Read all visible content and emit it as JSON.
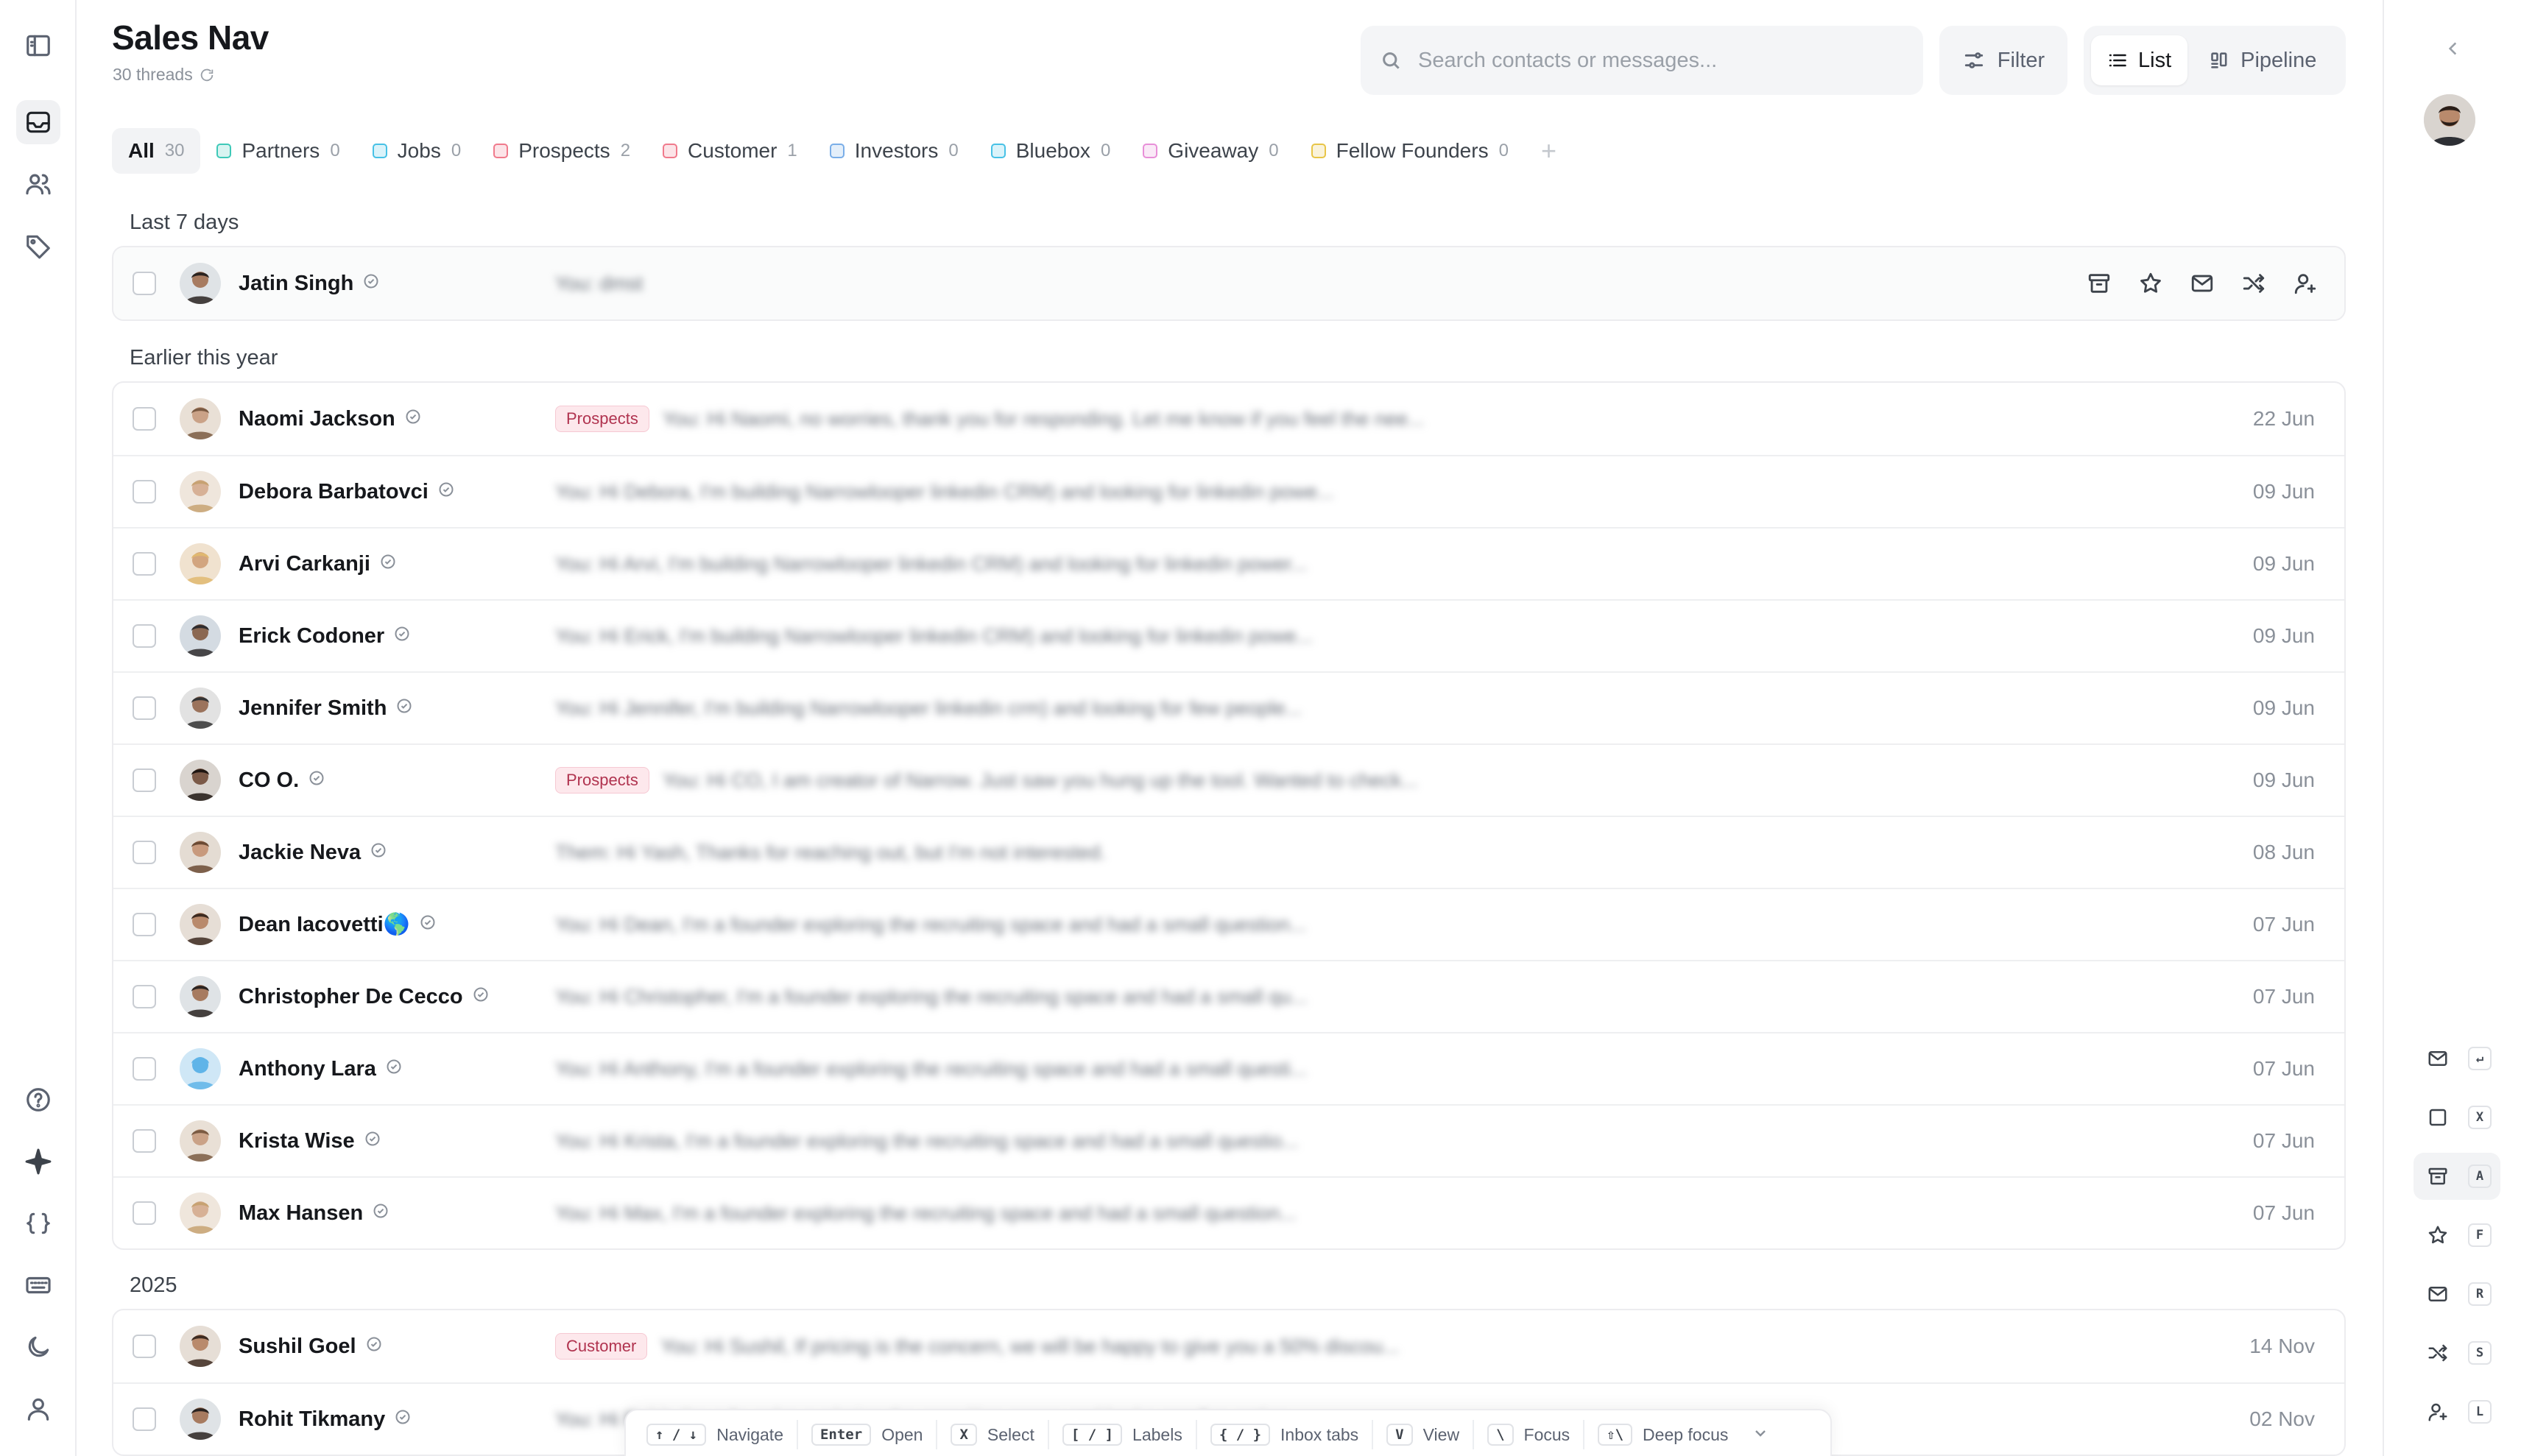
{
  "header": {
    "title": "Sales Nav",
    "subtitle": "30 threads",
    "search_placeholder": "Search contacts or messages...",
    "filter_label": "Filter",
    "view_list": "List",
    "view_pipeline": "Pipeline"
  },
  "tabs": [
    {
      "label": "All",
      "count": "30",
      "color": ""
    },
    {
      "label": "Partners",
      "count": "0",
      "color": "#3ec9b8"
    },
    {
      "label": "Jobs",
      "count": "0",
      "color": "#47c1e6"
    },
    {
      "label": "Prospects",
      "count": "2",
      "color": "#f07a8c"
    },
    {
      "label": "Customer",
      "count": "1",
      "color": "#f07a8c"
    },
    {
      "label": "Investors",
      "count": "0",
      "color": "#7aaee8"
    },
    {
      "label": "Bluebox",
      "count": "0",
      "color": "#47c1e6"
    },
    {
      "label": "Giveaway",
      "count": "0",
      "color": "#e88fd8"
    },
    {
      "label": "Fellow Founders",
      "count": "0",
      "color": "#e8c547"
    }
  ],
  "tab_add": "+",
  "sections": {
    "last7": "Last 7 days",
    "earlier": "Earlier this year",
    "y2025": "2025"
  },
  "threads_last7": [
    {
      "name": "Jatin Singh",
      "label": "",
      "preview": "You: dmst",
      "date": ""
    }
  ],
  "threads_earlier": [
    {
      "name": "Naomi Jackson",
      "label": "Prospects",
      "preview": "You: Hi Naomi, no worries, thank you for responding. Let me know if you feel the nee...",
      "date": "22 Jun"
    },
    {
      "name": "Debora Barbatovci",
      "label": "",
      "preview": "You: Hi Debora, I'm building Narrowlooper linkedin CRM) and looking for linkedin powe...",
      "date": "09 Jun"
    },
    {
      "name": "Arvi Carkanji",
      "label": "",
      "preview": "You: Hi Arvi, I'm building Narrowlooper linkedin CRM) and looking for linkedin power...",
      "date": "09 Jun"
    },
    {
      "name": "Erick Codoner",
      "label": "",
      "preview": "You: Hi Erick, I'm building Narrowlooper linkedin CRM) and looking for linkedin powe...",
      "date": "09 Jun"
    },
    {
      "name": "Jennifer Smith",
      "label": "",
      "preview": "You: Hi Jennifer, I'm building Narrowlooper linkedin crm) and looking for few people...",
      "date": "09 Jun"
    },
    {
      "name": "CO O.",
      "label": "Prospects",
      "preview": "You: Hi CO, I am creator of Narrow. Just saw you hung up the tool. Wanted to check...",
      "date": "09 Jun"
    },
    {
      "name": "Jackie Neva",
      "label": "",
      "preview": "Them: Hi Yash, Thanks for reaching out, but I'm not interested.",
      "date": "08 Jun"
    },
    {
      "name": "Dean Iacovetti🌎",
      "label": "",
      "preview": "You: Hi Dean, I'm a founder exploring the recruiting space and had a small question...",
      "date": "07 Jun"
    },
    {
      "name": "Christopher De Cecco",
      "label": "",
      "preview": "You: Hi Christopher, I'm a founder exploring the recruiting space and had a small qu...",
      "date": "07 Jun"
    },
    {
      "name": "Anthony Lara",
      "label": "",
      "preview": "You: Hi Anthony, I'm a founder exploring the recruiting space and had a small questi...",
      "date": "07 Jun"
    },
    {
      "name": "Krista Wise",
      "label": "",
      "preview": "You: Hi Krista, I'm a founder exploring the recruiting space and had a small questio...",
      "date": "07 Jun"
    },
    {
      "name": "Max Hansen",
      "label": "",
      "preview": "You: Hi Max, I'm a founder exploring the recruiting space and had a small question...",
      "date": "07 Jun"
    }
  ],
  "threads_2025": [
    {
      "name": "Sushil Goel",
      "label": "Customer",
      "preview": "You: Hi Sushil, If pricing is the concern, we will be happy to give you a 50% discou...",
      "date": "14 Nov"
    },
    {
      "name": "Rohit Tikmany",
      "label": "",
      "preview": "You: Hi Rohit, I'm a founder exploring the recruiting space and had a small question...",
      "date": "02 Nov"
    }
  ],
  "shortcuts_rail": [
    {
      "icon": "mail-reply-icon",
      "key": "↵"
    },
    {
      "icon": "checkbox-icon",
      "key": "X"
    },
    {
      "icon": "archive-icon",
      "key": "A"
    },
    {
      "icon": "star-icon",
      "key": "F"
    },
    {
      "icon": "mail-icon",
      "key": "R"
    },
    {
      "icon": "shuffle-icon",
      "key": "S"
    },
    {
      "icon": "user-plus-icon",
      "key": "L"
    }
  ],
  "kbar": [
    {
      "key": "↑ / ↓",
      "label": "Navigate"
    },
    {
      "key": "Enter",
      "label": "Open"
    },
    {
      "key": "X",
      "label": "Select"
    },
    {
      "key": "[ / ]",
      "label": "Labels"
    },
    {
      "key": "{ / }",
      "label": "Inbox tabs"
    },
    {
      "key": "V",
      "label": "View"
    },
    {
      "key": "\\",
      "label": "Focus"
    },
    {
      "key": "⇧\\",
      "label": "Deep focus"
    }
  ],
  "colors": {
    "accent": "#16181c",
    "label_bg": "#fde8ec",
    "label_fg": "#b0334f"
  }
}
